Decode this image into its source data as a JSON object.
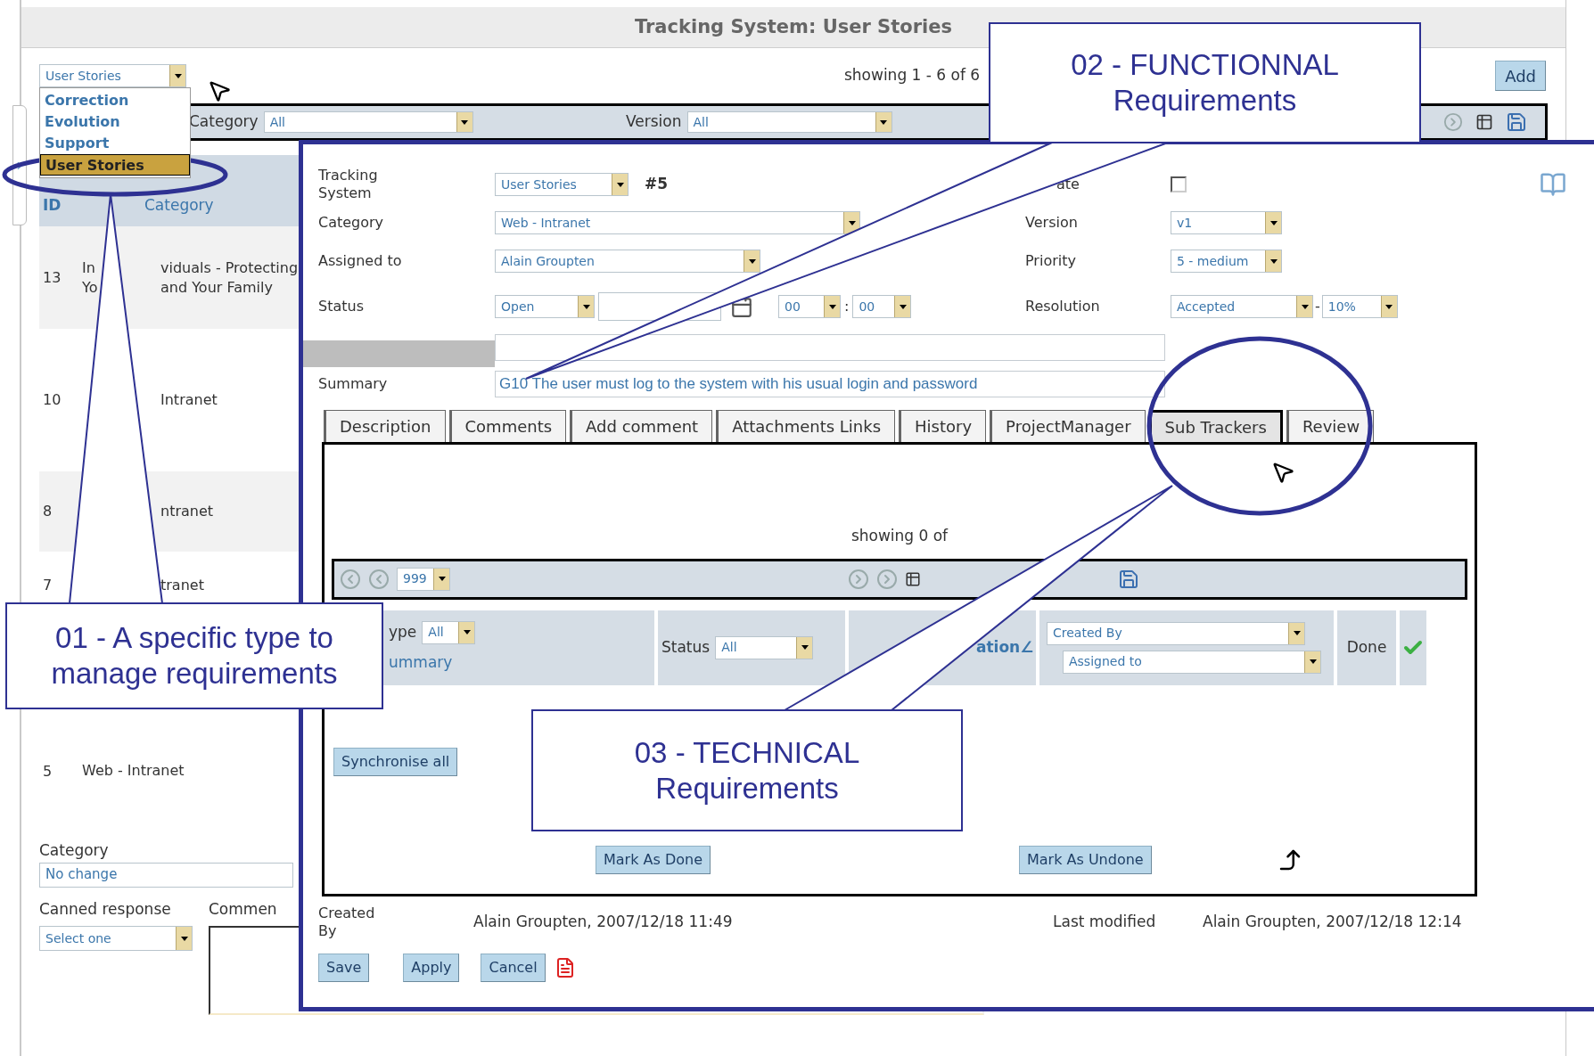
{
  "window": {
    "title": "Tracking System: User Stories"
  },
  "tracker_select": {
    "value": "User Stories",
    "options": [
      {
        "label": "Correction",
        "selected": false
      },
      {
        "label": "Evolution",
        "selected": false
      },
      {
        "label": "Support",
        "selected": false
      },
      {
        "label": "User Stories",
        "selected": true
      }
    ]
  },
  "showing": "showing 1 - 6 of 6",
  "add_button": "Add",
  "filters": [
    {
      "label": "Category",
      "value": "All"
    },
    {
      "label": "Version",
      "value": "All"
    }
  ],
  "list": {
    "columns": [
      "ID",
      "Category"
    ],
    "rows": [
      {
        "id": "13",
        "lines": [
          {
            "before": "In",
            "after": "viduals - Protecting"
          },
          {
            "before": "Yo",
            "after": "and Your Family"
          }
        ]
      },
      {
        "id": "10",
        "lines": [
          {
            "after": "Intranet"
          }
        ]
      },
      {
        "id": "8",
        "lines": [
          {
            "after": "ntranet"
          }
        ]
      },
      {
        "id": "7",
        "lines": [
          {
            "after": "tranet"
          }
        ]
      },
      {
        "id": "5",
        "lines": [
          {
            "before": "Web - Intranet"
          }
        ]
      }
    ]
  },
  "bulk": {
    "category_label": "Category",
    "category_value": "No change",
    "canned_label": "Canned response",
    "canned_value": "Select one",
    "comment_label": "Commen"
  },
  "ticket": {
    "tracking_system": {
      "label": "Tracking System",
      "value": "User Stories",
      "number": "#5"
    },
    "category": {
      "label": "Category",
      "value": "Web - Intranet"
    },
    "assigned_to": {
      "label": "Assigned to",
      "value": "Alain Groupten"
    },
    "status": {
      "label": "Status",
      "value": "Open",
      "hour": "00",
      "separator": ":",
      "minute": "00"
    },
    "summary": {
      "label": "Summary",
      "value": "G10 The user must log to the system with his usual login and password"
    },
    "private": {
      "label": "ate",
      "checked": false
    },
    "version": {
      "label": "Version",
      "value": "v1"
    },
    "priority": {
      "label": "Priority",
      "value": "5 - medium"
    },
    "resolution": {
      "label": "Resolution",
      "value": "Accepted",
      "separator": "-",
      "percent": "10%"
    },
    "tabs": [
      {
        "label": "Description",
        "selected": false
      },
      {
        "label": "Comments",
        "selected": false
      },
      {
        "label": "Add comment",
        "selected": false
      },
      {
        "label": "Attachments Links",
        "selected": false
      },
      {
        "label": "History",
        "selected": false
      },
      {
        "label": "ProjectManager",
        "selected": false
      },
      {
        "label": "Sub Trackers",
        "selected": true
      },
      {
        "label": "Review",
        "selected": false
      }
    ],
    "sub_trackers": {
      "showing": "showing 0 of",
      "page_size": "999",
      "type_label": "ype",
      "type_value": "All",
      "summary_link": "ummary",
      "status_label": "Status",
      "status_value": "All",
      "relation_link": "ation∠",
      "created_by": "Created By",
      "assigned_to": "Assigned to",
      "done_label": "Done",
      "synchronise": "Synchronise all",
      "mark_done": "Mark As Done",
      "mark_undone": "Mark As Undone"
    },
    "created": {
      "label": "Created By",
      "value": "Alain Groupten, 2007/12/18 11:49"
    },
    "modified": {
      "label": "Last modified",
      "value": "Alain Groupten, 2007/12/18 12:14"
    },
    "buttons": [
      "Save",
      "Apply",
      "Cancel"
    ]
  },
  "callouts": [
    {
      "lines": [
        "01 - A specific type to",
        "manage requirements"
      ]
    },
    {
      "lines": [
        "02 - FUNCTIONNAL",
        "Requirements"
      ]
    },
    {
      "lines": [
        "03 - TECHNICAL",
        "Requirements"
      ]
    }
  ]
}
